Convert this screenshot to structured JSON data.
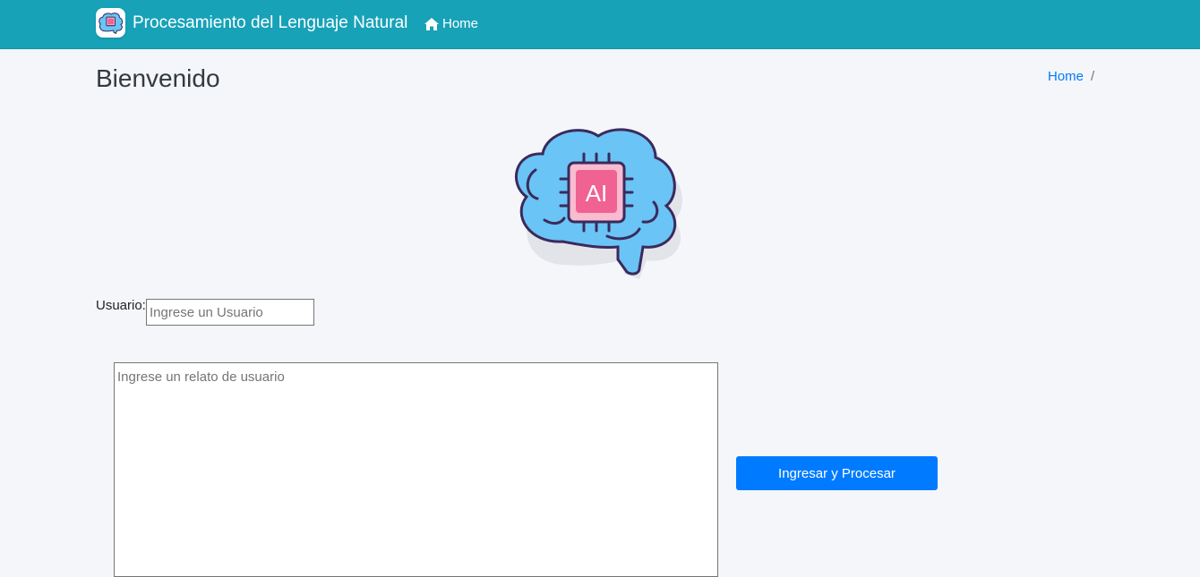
{
  "navbar": {
    "brand_text": "Procesamiento del Lenguaje Natural",
    "brand_logo_icon": "brain-ai-icon",
    "home_label": "Home",
    "home_icon": "home-icon",
    "background_color": "#17a2b8"
  },
  "content_header": {
    "title": "Bienvenido",
    "breadcrumb": {
      "items": [
        "Home"
      ],
      "separator": "/"
    }
  },
  "hero": {
    "image_icon": "brain-ai-icon",
    "image_text": "AI"
  },
  "form": {
    "user_label": "Usuario:",
    "user_placeholder": "Ingrese un Usuario",
    "user_value": "",
    "story_placeholder": "Ingrese un relato de usuario",
    "story_value": "",
    "submit_label": "Ingresar y Procesar",
    "submit_color": "#007bff"
  }
}
